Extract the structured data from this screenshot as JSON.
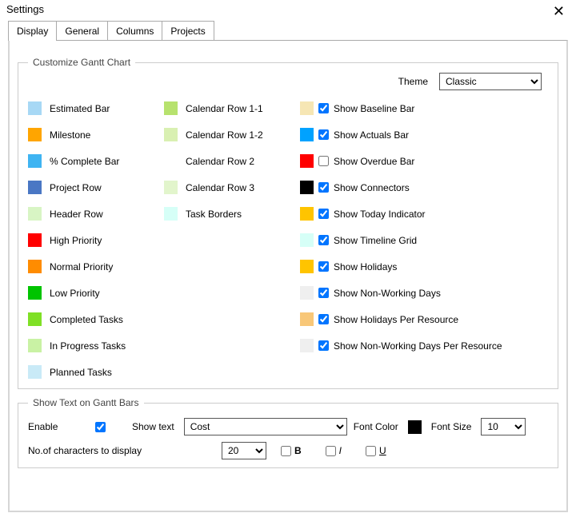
{
  "window": {
    "title": "Settings",
    "close_glyph": "✕"
  },
  "tabs": [
    {
      "label": "Display",
      "active": true
    },
    {
      "label": "General",
      "active": false
    },
    {
      "label": "Columns",
      "active": false
    },
    {
      "label": "Projects",
      "active": false
    }
  ],
  "customize": {
    "legend": "Customize Gantt Chart",
    "theme_label": "Theme",
    "theme_value": "Classic",
    "col1": [
      {
        "label": "Estimated Bar",
        "color": "#a7d8f5"
      },
      {
        "label": "Milestone",
        "color": "#ffa500"
      },
      {
        "label": "% Complete Bar",
        "color": "#3fb4f2"
      },
      {
        "label": "Project Row",
        "color": "#4a77c4"
      },
      {
        "label": "Header Row",
        "color": "#d8f5c4"
      },
      {
        "label": "High Priority",
        "color": "#ff0000"
      },
      {
        "label": "Normal Priority",
        "color": "#ff8c00"
      },
      {
        "label": "Low Priority",
        "color": "#00c400"
      },
      {
        "label": "Completed Tasks",
        "color": "#7fe026"
      },
      {
        "label": "In Progress Tasks",
        "color": "#c9f2a4"
      },
      {
        "label": "Planned Tasks",
        "color": "#c9eaf7"
      }
    ],
    "col2": [
      {
        "label": "Calendar Row 1-1",
        "color": "#b7e26e"
      },
      {
        "label": "Calendar Row 1-2",
        "color": "#d9f0b2"
      },
      {
        "label": "Calendar Row 2",
        "color": ""
      },
      {
        "label": "Calendar Row 3",
        "color": "#e2f5cc"
      },
      {
        "label": "Task Borders",
        "color": "#d6fff7"
      }
    ],
    "col3": [
      {
        "label": "Show Baseline Bar",
        "color": "#f6e6b4",
        "checked": true
      },
      {
        "label": "Show Actuals Bar",
        "color": "#00a2ff",
        "checked": true
      },
      {
        "label": "Show Overdue Bar",
        "color": "#ff0000",
        "checked": false
      },
      {
        "label": "Show Connectors",
        "color": "#000000",
        "checked": true
      },
      {
        "label": "Show Today Indicator",
        "color": "#ffc400",
        "checked": true
      },
      {
        "label": "Show Timeline Grid",
        "color": "#d6fff7",
        "checked": true
      },
      {
        "label": "Show Holidays",
        "color": "#ffc400",
        "checked": true
      },
      {
        "label": "Show Non-Working Days",
        "color": "#efefef",
        "checked": true
      },
      {
        "label": "Show Holidays Per Resource",
        "color": "#f8c778",
        "checked": true
      },
      {
        "label": "Show Non-Working Days Per Resource",
        "color": "#efefef",
        "checked": true
      }
    ]
  },
  "textbars": {
    "legend": "Show Text on Gantt Bars",
    "enable_label": "Enable",
    "enable_checked": true,
    "showtext_label": "Show text",
    "showtext_value": "Cost",
    "fontcolor_label": "Font Color",
    "fontcolor_value": "#000000",
    "fontsize_label": "Font Size",
    "fontsize_value": "10",
    "chars_label": "No.of characters to display",
    "chars_value": "20",
    "bold_label": "B",
    "bold_checked": false,
    "italic_label": "I",
    "italic_checked": false,
    "underline_label": "U",
    "underline_checked": false
  }
}
